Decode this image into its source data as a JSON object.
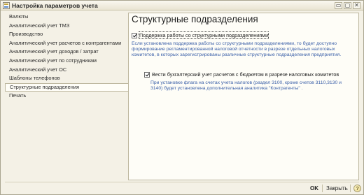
{
  "window": {
    "title": "Настройка параметров учета",
    "controls": [
      "▭",
      "▢",
      "✕"
    ]
  },
  "sidebar": {
    "items": [
      {
        "label": "Валюты"
      },
      {
        "label": "Аналитический учет ТМЗ"
      },
      {
        "label": "Производство"
      },
      {
        "label": "Аналитический учет расчетов с контрагентами"
      },
      {
        "label": "Аналитический учет доходов / затрат"
      },
      {
        "label": "Аналитический учет по сотрудникам"
      },
      {
        "label": "Аналитический учет ОС"
      },
      {
        "label": "Шаблоны телефонов"
      },
      {
        "label": "Структурные подразделения",
        "active": true
      },
      {
        "label": "Печать"
      }
    ]
  },
  "panel": {
    "title": "Структурные подразделения",
    "checkbox1": {
      "label": "Поддержка работы со структурными подразделениями",
      "checked": true
    },
    "info1": "Если установлена поддержка работы со структурными подразделениями, то будет доступно формирование регламентированной налоговой отчетности в разрезе отдельных налоговых комитетов, в которых зарегистрированы различные структурные подразделения предприятия.",
    "checkbox2": {
      "label": "Вести бухгалтерский учет расчетов с бюджетом в разрезе налоговых комитетов",
      "checked": true
    },
    "info2": "При установке флага на счетах учета налогов (раздел 3100, кроме счетов 3110,3130 и 3140) будет установлена дополнительная аналитика \"Контрагенты\" ."
  },
  "footer": {
    "ok_label": "OK",
    "close_label": "Закрыть",
    "help_label": "?"
  },
  "colors": {
    "info_text": "#3a5fa8",
    "background": "#f4f1e6",
    "panel_background": "#fefdf7"
  },
  "icons": {
    "app": "app-settings-icon",
    "help": "help-icon"
  }
}
